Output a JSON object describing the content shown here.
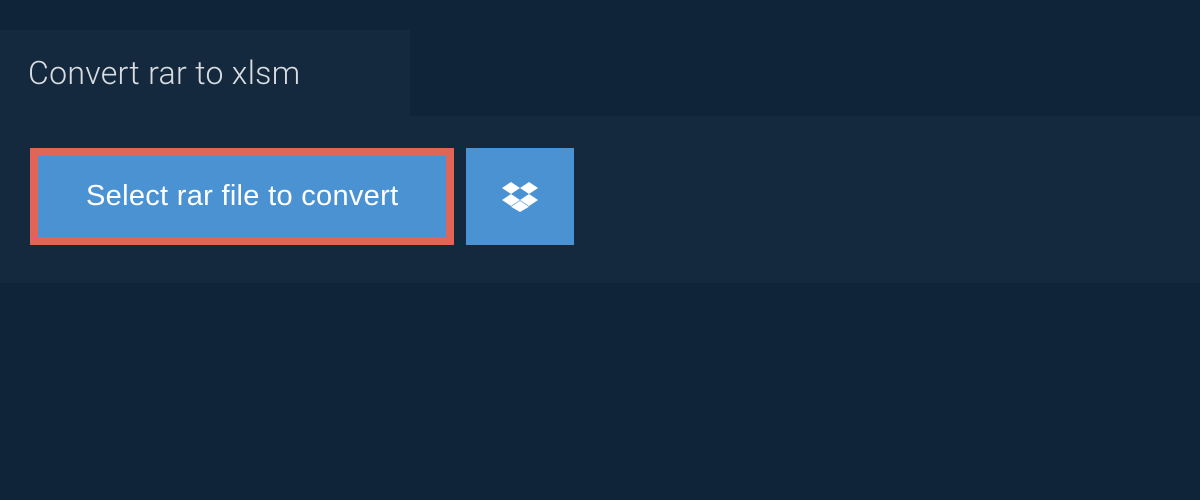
{
  "tab": {
    "title": "Convert rar to xlsm"
  },
  "buttons": {
    "select_file_label": "Select rar file to convert"
  }
}
